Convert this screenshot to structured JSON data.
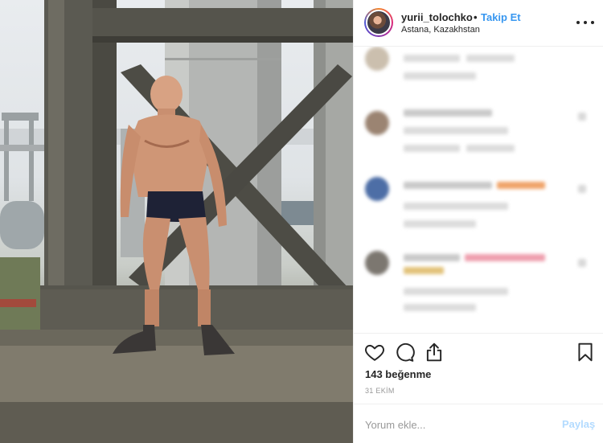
{
  "post": {
    "username": "yurii_tolochko",
    "separator": "•",
    "follow_label": "Takip Et",
    "location": "Astana, Kazakhstan",
    "likes_text": "143 beğenme",
    "date_text": "31 EKİM",
    "comment_placeholder": "Yorum ekle...",
    "share_label": "Paylaş"
  },
  "icons": {
    "more": "more-options-icon",
    "like": "heart-icon",
    "comment": "comment-icon",
    "share": "share-icon",
    "save": "bookmark-icon"
  },
  "colors": {
    "accent": "#3897f0",
    "share_disabled": "#b3dbff",
    "text": "#262626",
    "muted": "#999999",
    "border": "#efefef"
  }
}
